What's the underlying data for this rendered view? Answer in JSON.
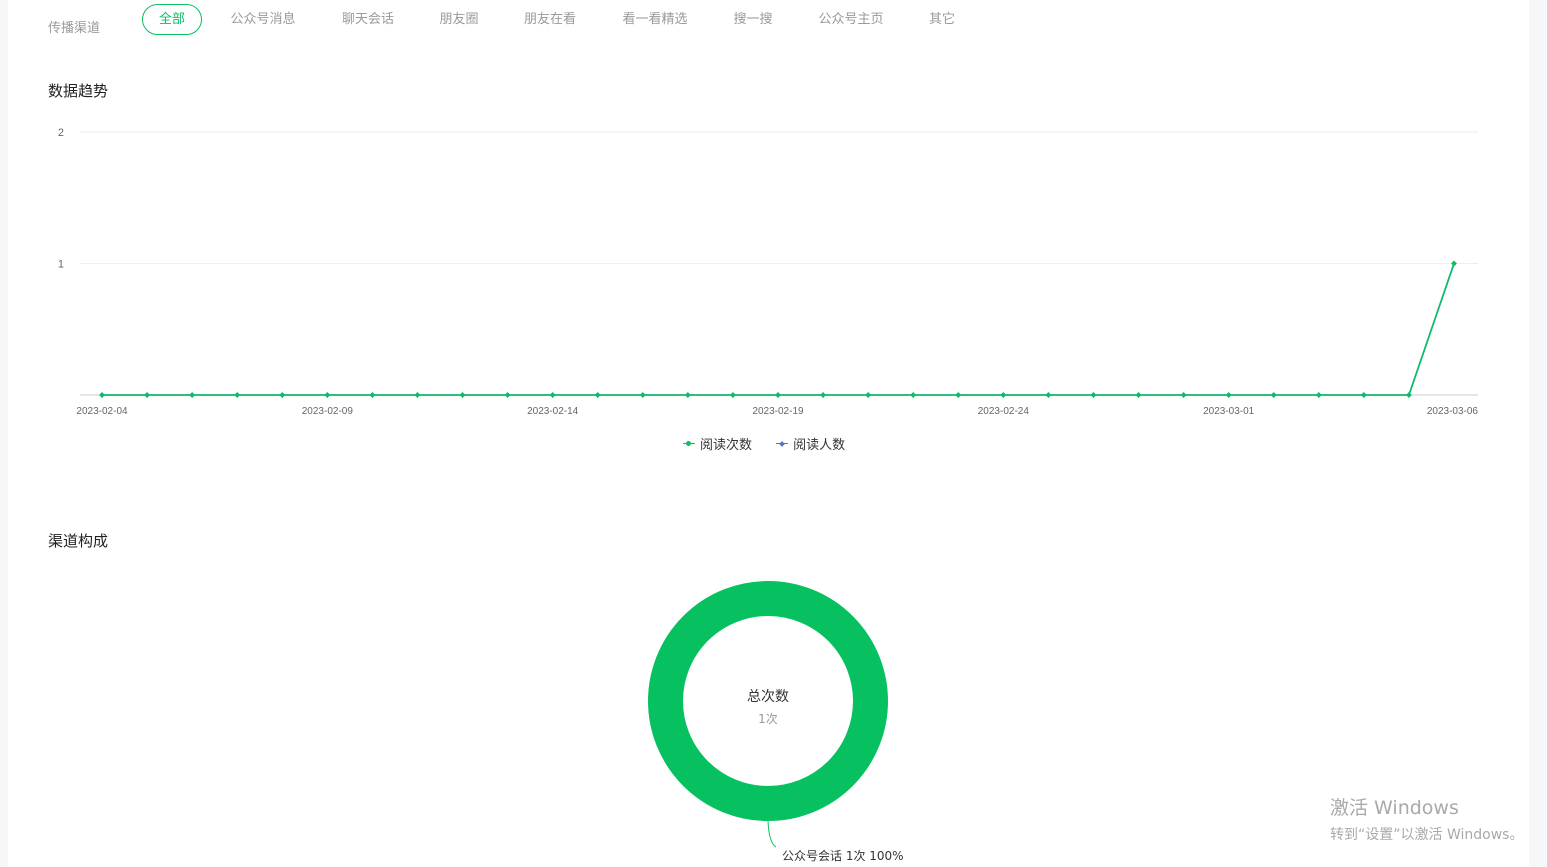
{
  "channel": {
    "label": "传播渠道",
    "tabs": [
      {
        "label": "全部",
        "active": true
      },
      {
        "label": "公众号消息",
        "active": false
      },
      {
        "label": "聊天会话",
        "active": false
      },
      {
        "label": "朋友圈",
        "active": false
      },
      {
        "label": "朋友在看",
        "active": false
      },
      {
        "label": "看一看精选",
        "active": false
      },
      {
        "label": "搜一搜",
        "active": false
      },
      {
        "label": "公众号主页",
        "active": false
      },
      {
        "label": "其它",
        "active": false
      }
    ]
  },
  "trend": {
    "title": "数据趋势",
    "legend": [
      {
        "label": "阅读次数",
        "color": "#07c160"
      },
      {
        "label": "阅读人数",
        "color": "#5b6ec8"
      }
    ]
  },
  "composition": {
    "title": "渠道构成",
    "center_title": "总次数",
    "center_value": "1次",
    "slice_label": "公众号会话 1次 100%"
  },
  "watermark": {
    "line1": "激活 Windows",
    "line2": "转到“设置”以激活 Windows。"
  },
  "chart_data": [
    {
      "type": "line",
      "x": [
        "2023-02-04",
        "2023-02-05",
        "2023-02-06",
        "2023-02-07",
        "2023-02-08",
        "2023-02-09",
        "2023-02-10",
        "2023-02-11",
        "2023-02-12",
        "2023-02-13",
        "2023-02-14",
        "2023-02-15",
        "2023-02-16",
        "2023-02-17",
        "2023-02-18",
        "2023-02-19",
        "2023-02-20",
        "2023-02-21",
        "2023-02-22",
        "2023-02-23",
        "2023-02-24",
        "2023-02-25",
        "2023-02-26",
        "2023-02-27",
        "2023-02-28",
        "2023-03-01",
        "2023-03-02",
        "2023-03-03",
        "2023-03-04",
        "2023-03-05",
        "2023-03-06"
      ],
      "xticks": [
        "2023-02-04",
        "2023-02-09",
        "2023-02-14",
        "2023-02-19",
        "2023-02-24",
        "2023-03-01",
        "2023-03-06"
      ],
      "yticks": [
        1,
        2
      ],
      "ylim": [
        0,
        2
      ],
      "series": [
        {
          "name": "阅读次数",
          "color": "#07c160",
          "values": [
            0,
            0,
            0,
            0,
            0,
            0,
            0,
            0,
            0,
            0,
            0,
            0,
            0,
            0,
            0,
            0,
            0,
            0,
            0,
            0,
            0,
            0,
            0,
            0,
            0,
            0,
            0,
            0,
            0,
            0,
            1
          ]
        },
        {
          "name": "阅读人数",
          "color": "#5b6ec8",
          "values": [
            0,
            0,
            0,
            0,
            0,
            0,
            0,
            0,
            0,
            0,
            0,
            0,
            0,
            0,
            0,
            0,
            0,
            0,
            0,
            0,
            0,
            0,
            0,
            0,
            0,
            0,
            0,
            0,
            0,
            0,
            1
          ]
        }
      ],
      "grid": true,
      "legend_position": "bottom"
    },
    {
      "type": "pie",
      "donut": true,
      "slices": [
        {
          "label": "公众号会话",
          "value": 1,
          "percent": 100,
          "color": "#07c160"
        }
      ]
    }
  ]
}
